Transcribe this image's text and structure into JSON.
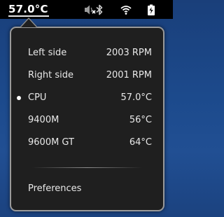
{
  "topbar": {
    "temperature": "57.0°C",
    "icons": [
      "volume-muted-icon",
      "bluetooth-icon",
      "wifi-icon",
      "battery-icon"
    ]
  },
  "menu": {
    "sensors": [
      {
        "label": "Left side",
        "value": "2003 RPM",
        "selected": false
      },
      {
        "label": "Right side",
        "value": "2001 RPM",
        "selected": false
      },
      {
        "label": "CPU",
        "value": "57.0°C",
        "selected": true
      },
      {
        "label": "9400M",
        "value": "56°C",
        "selected": false
      },
      {
        "label": "9600M GT",
        "value": "64°C",
        "selected": false
      }
    ],
    "preferences_label": "Preferences"
  }
}
